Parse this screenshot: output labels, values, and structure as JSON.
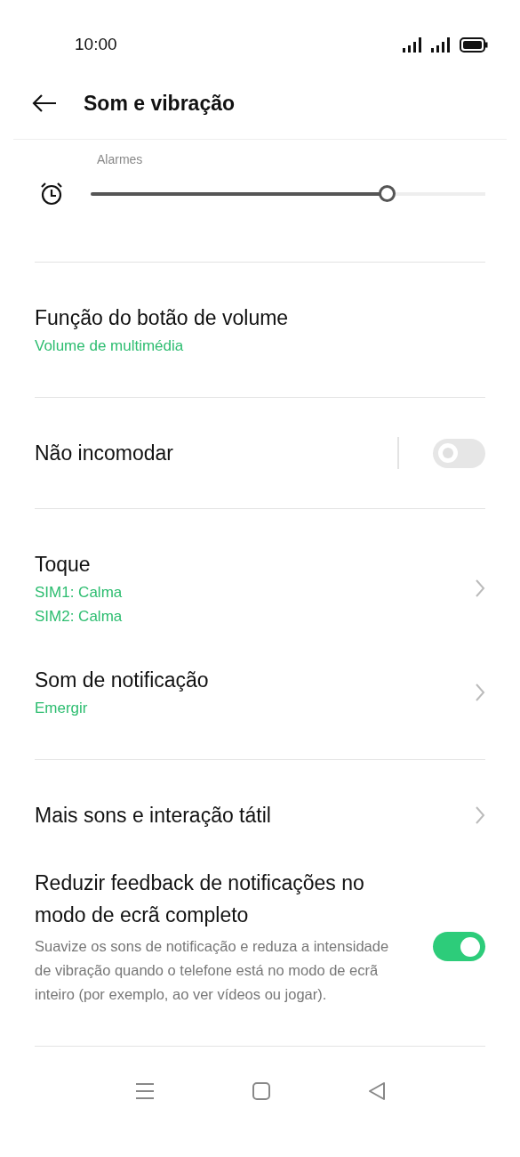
{
  "status_bar": {
    "time": "10:00"
  },
  "header": {
    "title": "Som e vibração"
  },
  "alarm_volume": {
    "label": "Alarmes",
    "level": 0.75
  },
  "sections": [
    {
      "items": [
        {
          "kind": "value",
          "title": "Função do botão de volume",
          "values": [
            "Volume de multimédia"
          ]
        }
      ]
    },
    {
      "items": [
        {
          "kind": "switch",
          "title": "Não incomodar",
          "on": false
        }
      ]
    },
    {
      "items": [
        {
          "kind": "link",
          "title": "Toque",
          "values": [
            "SIM1: Calma",
            "SIM2: Calma"
          ]
        },
        {
          "kind": "link",
          "title": "Som de notificação",
          "values": [
            "Emergir"
          ]
        }
      ]
    },
    {
      "items": [
        {
          "kind": "link",
          "title": "Mais sons e interação tátil"
        },
        {
          "kind": "switch",
          "title": "Reduzir feedback de notificações no modo de ecrã completo",
          "description": "Suavize os sons de notificação e reduza a intensidade de vibração quando o telefone está no modo de ecrã inteiro (por exemplo, ao ver vídeos ou jogar).",
          "on": true
        }
      ]
    }
  ]
}
